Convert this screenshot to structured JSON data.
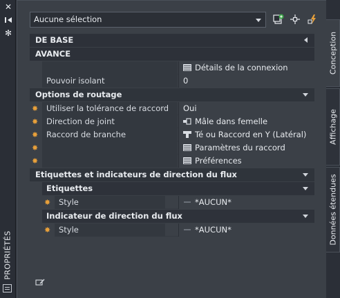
{
  "strip": {
    "title": "PROPRIÉTÉS",
    "icons": [
      "close-icon",
      "pin-icon",
      "settings-icon",
      "palette-icon"
    ]
  },
  "toolbar": {
    "selection": "Aucune sélection",
    "icons": [
      "add-selection-icon",
      "pick-icon",
      "quick-select-icon"
    ]
  },
  "categories": {
    "de_base": "DE BASE",
    "avance": "AVANCE",
    "options_routage": "Options de routage",
    "etiquettes_flux": "Etiquettes et indicateurs de direction du flux",
    "etiquettes": "Etiquettes",
    "indicateur": "Indicateur de direction du flux"
  },
  "rows": {
    "details_connexion": "Détails de la connexion",
    "pouvoir_isolant_name": "Pouvoir isolant",
    "pouvoir_isolant_value": "0",
    "tolerance_name": "Utiliser la tolérance de raccord",
    "tolerance_value": "Oui",
    "direction_name": "Direction de joint",
    "direction_value": "Mâle dans femelle",
    "raccord_name": "Raccord de branche",
    "raccord_value": "Té ou Raccord en Y (Latéral)",
    "parametres": "Paramètres du raccord",
    "preferences": "Préférences",
    "style1_name": "Style",
    "style1_value": "*AUCUN*",
    "style2_name": "Style",
    "style2_value": "*AUCUN*"
  },
  "tabs": {
    "conception": "Conception",
    "affichage": "Affichage",
    "donnees": "Données étendues"
  },
  "colors": {
    "panel_bg": "#3b4047",
    "category_bg": "#2d3139",
    "star_marker": "#e8a03a"
  }
}
